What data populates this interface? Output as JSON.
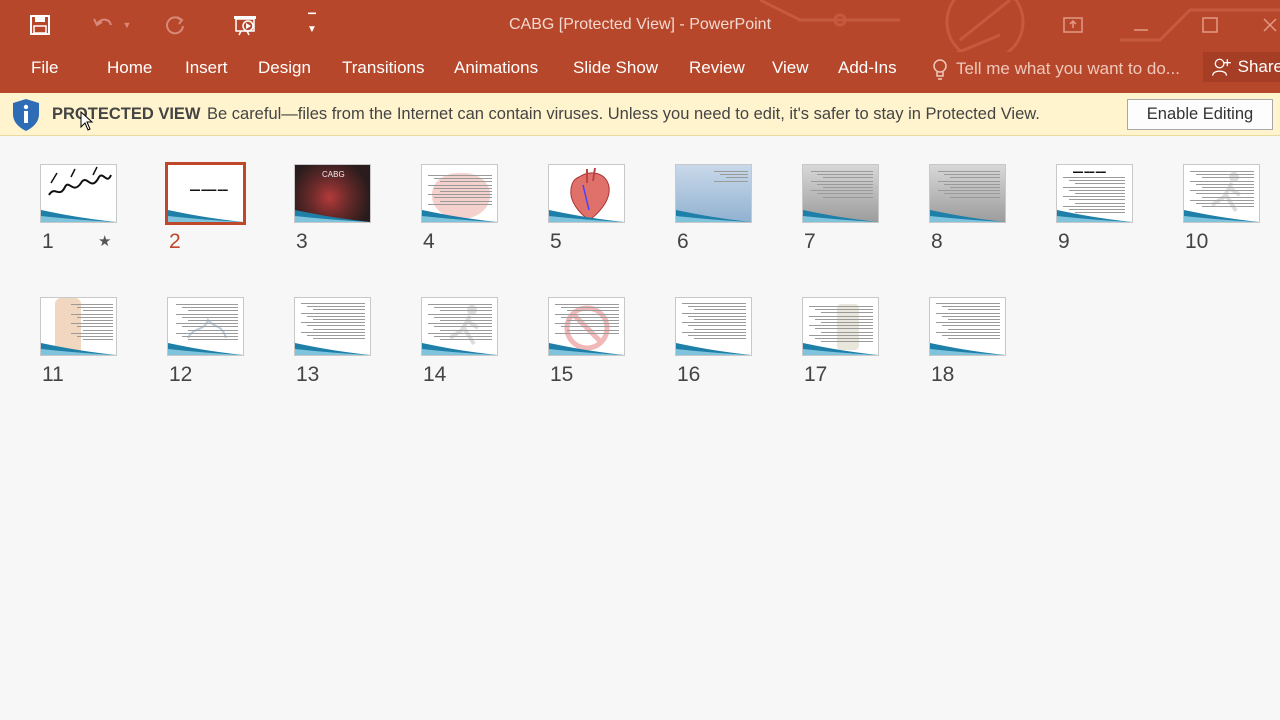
{
  "window": {
    "title": "CABG [Protected View] - PowerPoint"
  },
  "qat": {
    "save_icon": "save-icon",
    "undo_icon": "undo-icon",
    "redo_icon": "redo-icon",
    "present_icon": "start-from-beginning-icon",
    "customize_icon": "customize-qat-icon"
  },
  "ribbon": {
    "tabs": [
      "File",
      "Home",
      "Insert",
      "Design",
      "Transitions",
      "Animations",
      "Slide Show",
      "Review",
      "View",
      "Add-Ins"
    ],
    "tell_me_placeholder": "Tell me what you want to do...",
    "share_label": "Share"
  },
  "protected_view": {
    "label": "PROTECTED VIEW",
    "message": "Be careful—files from the Internet can contain viruses. Unless you need to edit, it's safer to stay in Protected View.",
    "button": "Enable Editing"
  },
  "sorter": {
    "selected": "2",
    "slides": [
      {
        "number": "1",
        "kind": "calligraphy",
        "has_animation": true
      },
      {
        "number": "2",
        "kind": "title"
      },
      {
        "number": "3",
        "kind": "photo-surgery",
        "label": "CABG"
      },
      {
        "number": "4",
        "kind": "heart-faded"
      },
      {
        "number": "5",
        "kind": "heart-diagram"
      },
      {
        "number": "6",
        "kind": "blue-photo"
      },
      {
        "number": "7",
        "kind": "gray-photo"
      },
      {
        "number": "8",
        "kind": "gray-photo"
      },
      {
        "number": "9",
        "kind": "text-bold"
      },
      {
        "number": "10",
        "kind": "runner"
      },
      {
        "number": "11",
        "kind": "legs"
      },
      {
        "number": "12",
        "kind": "drawing"
      },
      {
        "number": "13",
        "kind": "text"
      },
      {
        "number": "14",
        "kind": "runner"
      },
      {
        "number": "15",
        "kind": "no-smoking"
      },
      {
        "number": "16",
        "kind": "text"
      },
      {
        "number": "17",
        "kind": "bottle"
      },
      {
        "number": "18",
        "kind": "text"
      }
    ]
  },
  "colors": {
    "accent": "#b7472a",
    "selection": "#c0482a",
    "protected_bar": "#fff4ce",
    "shield": "#2e6db6"
  }
}
